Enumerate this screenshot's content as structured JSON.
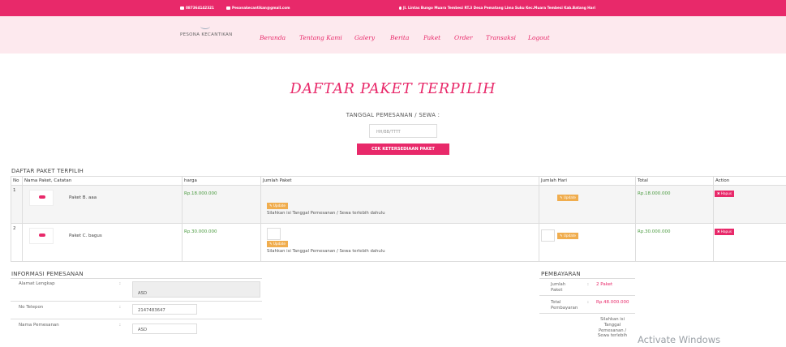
{
  "topbar": {
    "phone": "087364142321",
    "email": "Pesonakecantikan@gmail.com",
    "address": "Jl. Lintas Bungo Muara Tembesi RT.3 Desa Pematang Lima Suku Kec.Muara Tembesi Kab.Batang Hari"
  },
  "brand": {
    "name": "PESONA KECANTIKAN"
  },
  "nav": {
    "beranda": "Beranda",
    "tentang": "Tentang Kami",
    "galery": "Galery",
    "berita": "Berita",
    "paket": "Paket",
    "order": "Order",
    "transaksi": "Transaksi",
    "logout": "Logout"
  },
  "page": {
    "title": "DAFTAR PAKET TERPILIH",
    "date_label": "TANGGAL PEMESANAN / SEWA :",
    "date_placeholder": "HH/BB/TTTT",
    "check_button": "CEK KETERSEDIAAN PAKET"
  },
  "table": {
    "section_title": "DAFTAR PAKET TERPILIH",
    "headers": {
      "no": "No",
      "name": "Nama Paket, Catatan",
      "harga": "harga",
      "jumlah_paket": "Jumlah Paket",
      "jumlah_hari": "Jumlah Hari",
      "total": "Total",
      "action": "Action"
    },
    "update_label": "Update",
    "delete_label": "Hapus",
    "rows": [
      {
        "no": "1",
        "name": "Paket B. aaa",
        "harga": "Rp.18.000.000",
        "note": "Silahkan isi Tanggal Pemesanan / Sewa terlebih dahulu",
        "total": "Rp.18.000.000"
      },
      {
        "no": "2",
        "name": "Paket C. bagus",
        "harga": "Rp.30.000.000",
        "note": "Silahkan isi Tanggal Pemesanan / Sewa terlebih dahulu",
        "total": "Rp.30.000.000"
      }
    ]
  },
  "info": {
    "section_title": "INFORMASI PEMESANAN",
    "alamat_label": "Alamat Lengkap",
    "alamat_value": "ASD",
    "telepon_label": "No Telepon",
    "telepon_value": "2147483647",
    "nama_label": "Nama Pemesanan",
    "nama_value": "ASD"
  },
  "payment": {
    "section_title": "PEMBAYARAN",
    "jumlah_label_1": "Jumlah",
    "jumlah_label_2": "Paket",
    "jumlah_value": "2 Paket",
    "total_label_1": "Total",
    "total_label_2": "Pembayaran",
    "total_value": "Rp.48.000.000",
    "note_lines": [
      "Silahkan isi",
      "Tanggal",
      "Pemesanan /",
      "Sewa terlebih"
    ]
  },
  "watermark": "Activate Windows",
  "colors": {
    "accent": "#e8296a",
    "nav_bg": "#fde9ee",
    "warning": "#f0ad4e",
    "price": "#4a9a3f"
  }
}
